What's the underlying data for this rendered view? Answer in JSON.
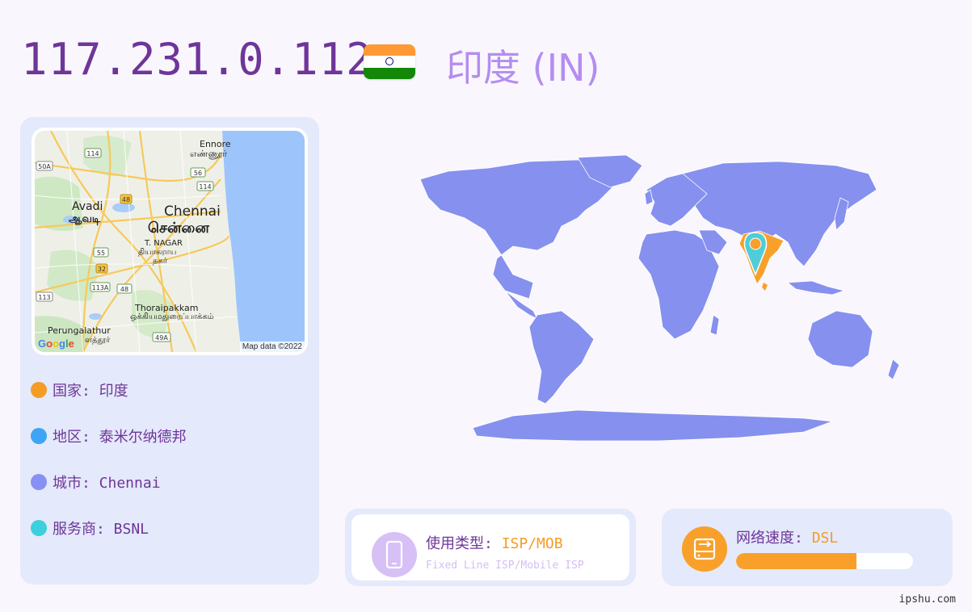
{
  "header": {
    "ip": "117.231.0.112",
    "country_title": "印度 (IN)"
  },
  "map": {
    "labels": {
      "ennore": "Ennore",
      "ennore_ta": "எண்ணூர்",
      "avadi": "Avadi",
      "avadi_ta": "ஆவடி",
      "chennai": "Chennai",
      "chennai_ta": "சென்னை",
      "tnagar": "T. NAGAR",
      "tnagar_ta1": "தியாகராய",
      "tnagar_ta2": "நகர்",
      "thoraipakkam": "Thoraipakkam",
      "thoraipakkam_ta": "ஒக்கியமதுரைப்பாக்கம்",
      "perungalathur": "Perungalathur",
      "perungalathur_ta": "ளத்தூர்",
      "shields": [
        "114",
        "50A",
        "56",
        "114",
        "48",
        "55",
        "32",
        "113A",
        "48",
        "113",
        "49A"
      ]
    },
    "credit": "Map data ©2022",
    "logo": "Google"
  },
  "info": {
    "country": "国家: 印度",
    "region": "地区: 泰米尔纳德邦",
    "city": "城市: Chennai",
    "isp": "服务商: BSNL"
  },
  "usage": {
    "label": "使用类型: ",
    "value": "ISP/MOB",
    "sub": "Fixed Line ISP/Mobile ISP"
  },
  "speed": {
    "label": "网络速度: ",
    "value": "DSL",
    "level": 0.68
  },
  "colors": {
    "ip": "#6f3598",
    "country_title": "#b58df0",
    "dot_country": "#f59c27",
    "dot_region": "#3da5f4",
    "dot_city": "#8791f2",
    "dot_isp": "#3cd0dc",
    "land": "#8690ee",
    "highlight": "#f8a02a",
    "pin": "#4fcdd9"
  },
  "icons": {
    "usage": "mobile-phone-icon",
    "speed": "network-drive-icon",
    "pin": "map-pin-icon"
  },
  "watermark": "ipshu.com"
}
